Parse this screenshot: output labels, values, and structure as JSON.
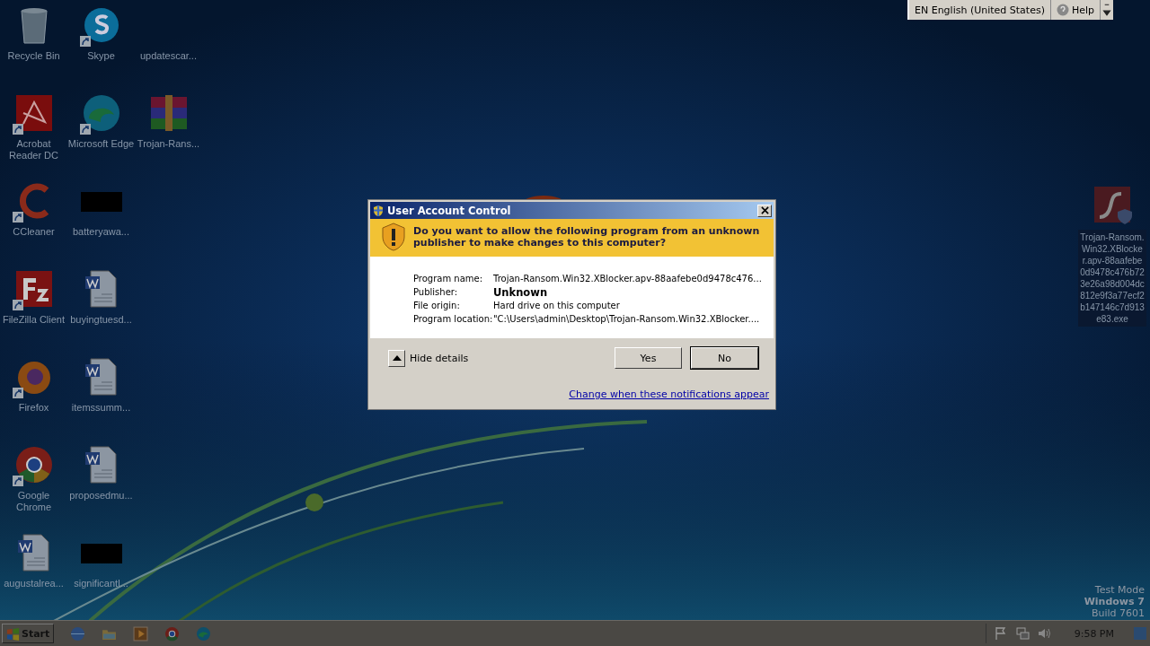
{
  "desktop": {
    "columns": [
      [
        {
          "label": "Recycle Bin",
          "kind": "recycle",
          "shortcut": false
        },
        {
          "label": "Acrobat Reader DC",
          "kind": "acrobat",
          "shortcut": true
        },
        {
          "label": "CCleaner",
          "kind": "ccleaner",
          "shortcut": true
        },
        {
          "label": "FileZilla Client",
          "kind": "filezilla",
          "shortcut": true
        },
        {
          "label": "Firefox",
          "kind": "firefox",
          "shortcut": true
        },
        {
          "label": "Google Chrome",
          "kind": "chrome",
          "shortcut": true
        },
        {
          "label": "augustalrea...",
          "kind": "word",
          "shortcut": false
        }
      ],
      [
        {
          "label": "Skype",
          "kind": "skype",
          "shortcut": true
        },
        {
          "label": "Microsoft Edge",
          "kind": "edge",
          "shortcut": true
        },
        {
          "label": "batteryawa...",
          "kind": "black",
          "shortcut": false
        },
        {
          "label": "buyingtuesd...",
          "kind": "word",
          "shortcut": false
        },
        {
          "label": "itemssumm...",
          "kind": "word",
          "shortcut": false
        },
        {
          "label": "proposedmu...",
          "kind": "word",
          "shortcut": false
        },
        {
          "label": "significantl...",
          "kind": "black",
          "shortcut": false
        }
      ],
      [
        {
          "label": "updatescar...",
          "kind": "blank",
          "shortcut": false
        },
        {
          "label": "Trojan-Rans...",
          "kind": "winrar",
          "shortcut": false
        }
      ]
    ],
    "selected_file": {
      "label": "Trojan-Ransom.Win32.XBlocker.apv-88aafebe0d9478c476b723e26a98d004dc812e9f3a77ecf2b147146c7d913e83.exe",
      "kind": "flash",
      "selected": true
    },
    "watermark_text": [
      "Test Mode",
      "Windows 7",
      "Build 7601"
    ]
  },
  "language_bar": {
    "language": "EN English (United States)",
    "help": "Help"
  },
  "dialog": {
    "title": "User Account Control",
    "question": "Do you want to allow the following program from an unknown publisher to make changes to this computer?",
    "details": [
      {
        "label": "Program name:",
        "value": "Trojan-Ransom.Win32.XBlocker.apv-88aafebe0d9478c476...",
        "bold": false
      },
      {
        "label": "Publisher:",
        "value": "Unknown",
        "bold": true
      },
      {
        "label": "File origin:",
        "value": "Hard drive on this computer",
        "bold": false
      },
      {
        "label": "Program location:",
        "value": "\"C:\\Users\\admin\\Desktop\\Trojan-Ransom.Win32.XBlocker....",
        "bold": false
      }
    ],
    "details_toggle": {
      "label": "Hide details",
      "expanded": true
    },
    "buttons": [
      {
        "label": "Yes",
        "default": false
      },
      {
        "label": "No",
        "default": true
      }
    ],
    "link": "Change when these notifications appear"
  },
  "taskbar": {
    "start": "Start",
    "pinned": [
      {
        "kind": "ie"
      },
      {
        "kind": "explorer"
      },
      {
        "kind": "media"
      },
      {
        "kind": "chrome"
      },
      {
        "kind": "edge"
      }
    ],
    "tray": [
      {
        "kind": "flag"
      },
      {
        "kind": "network"
      },
      {
        "kind": "volume"
      }
    ],
    "clock": "9:58 PM"
  }
}
